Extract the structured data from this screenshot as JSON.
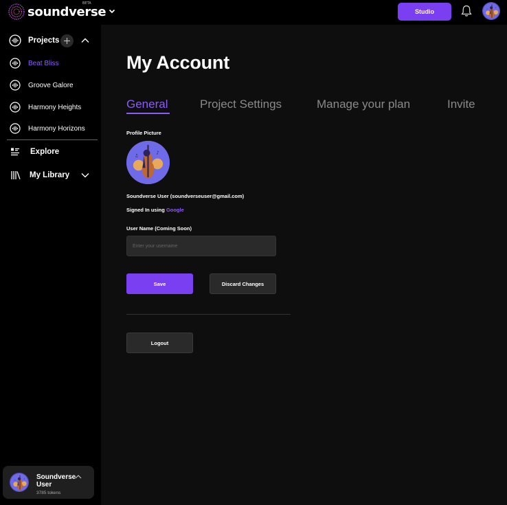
{
  "app": {
    "name": "soundverse",
    "beta": "BETA",
    "studio_label": "Studio",
    "accent": "#7b3ff2"
  },
  "sidebar": {
    "projects_label": "Projects",
    "projects": [
      {
        "label": "Beat Bliss",
        "active": true
      },
      {
        "label": "Groove Galore",
        "active": false
      },
      {
        "label": "Harmony Heights",
        "active": false
      },
      {
        "label": "Harmony Horizons",
        "active": false
      }
    ],
    "explore_label": "Explore",
    "library_label": "My Library",
    "user": {
      "name": "Soundverse User",
      "tokens": "3785 tokens"
    }
  },
  "main": {
    "title": "My Account",
    "tabs": [
      {
        "label": "General",
        "active": true
      },
      {
        "label": "Project Settings",
        "active": false
      },
      {
        "label": "Manage your plan",
        "active": false
      },
      {
        "label": "Invite",
        "active": false
      }
    ],
    "profile_picture_label": "Profile Picture",
    "account_line": "Soundverse User (soundverseuser@gmail.com)",
    "signed_in_prefix": "Signed In using",
    "signed_in_provider": "Google",
    "username_label": "User Name (Coming Soon)",
    "username_placeholder": "Enter your username",
    "save_label": "Save",
    "discard_label": "Discard Changes",
    "logout_label": "Logout"
  }
}
